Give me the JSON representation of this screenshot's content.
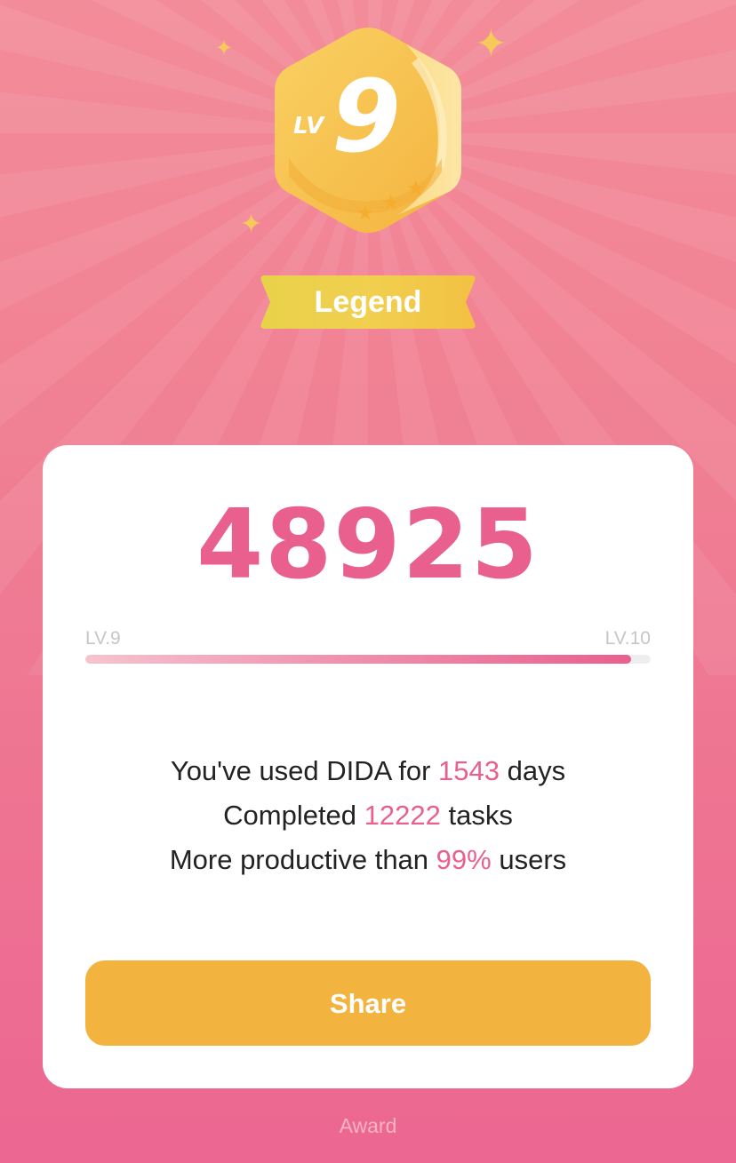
{
  "colors": {
    "accent": "#e9608e",
    "button": "#f2b43f",
    "badge_gold": "#f7c95a",
    "background_top": "#f38c99",
    "background_bottom": "#ec6792"
  },
  "badge": {
    "prefix": "LV",
    "level": "9",
    "stars": 3,
    "title": "Legend"
  },
  "score": "48925",
  "progress": {
    "from_label": "LV.9",
    "to_label": "LV.10",
    "fraction": 0.965
  },
  "stats": {
    "line1": {
      "before": "You've used DIDA for",
      "value": "1543",
      "after": "days"
    },
    "line2": {
      "before": "Completed",
      "value": "12222",
      "after": "tasks"
    },
    "line3": {
      "before": "More productive than",
      "value": "99%",
      "after": "users"
    }
  },
  "share_label": "Share",
  "footer_label": "Award",
  "icons": {
    "sparkle": "sparkle-icon",
    "star": "star-icon",
    "badge": "hexagon-badge-icon"
  }
}
